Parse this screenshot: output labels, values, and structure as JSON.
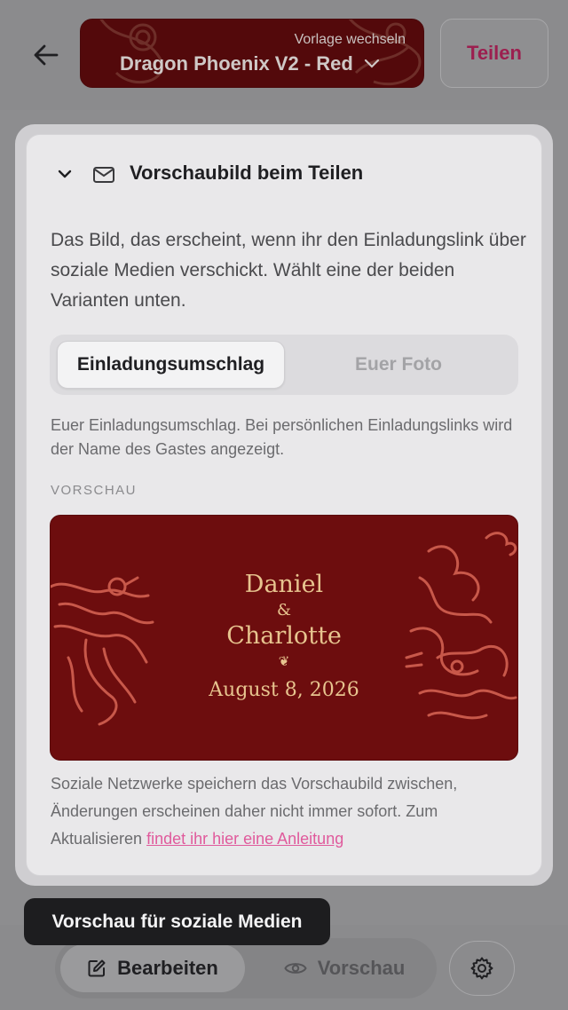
{
  "header": {
    "template_switch_label": "Vorlage wechseln",
    "template_name": "Dragon Phoenix V2 - Red",
    "share_label": "Teilen"
  },
  "section": {
    "title": "Vorschaubild beim Teilen",
    "description": "Das Bild, das erscheint, wenn ihr den Einladungslink über soziale Medien verschickt. Wählt eine der beiden Varianten unten.",
    "options": [
      {
        "label": "Einladungsumschlag",
        "selected": true
      },
      {
        "label": "Euer Foto",
        "selected": false
      }
    ],
    "option_note": "Euer Einladungsumschlag. Bei persönlichen Einladungslinks wird der Name des Gastes angezeigt.",
    "preview_label": "VORSCHAU",
    "preview": {
      "name1": "Daniel",
      "ampersand": "&",
      "name2": "Charlotte",
      "ornament": "❦",
      "date": "August 8, 2026"
    },
    "footer_text": "Soziale Netzwerke speichern das Vorschaubild zwischen, Änderungen erscheinen daher nicht immer sofort. Zum Aktualisieren ",
    "footer_link": "findet ihr hier eine Anleitung"
  },
  "tooltip": "Vorschau für soziale Medien",
  "bottom_nav": {
    "edit_label": "Bearbeiten",
    "preview_label": "Vorschau"
  },
  "colors": {
    "accent": "#9c1f4f",
    "link": "#e05a9c",
    "card_red": "#6d0d0e",
    "gold": "#e7c48f"
  },
  "icons": [
    "arrow-left-icon",
    "chevron-down-icon",
    "mail-icon",
    "edit-icon",
    "eye-icon",
    "gear-icon"
  ]
}
